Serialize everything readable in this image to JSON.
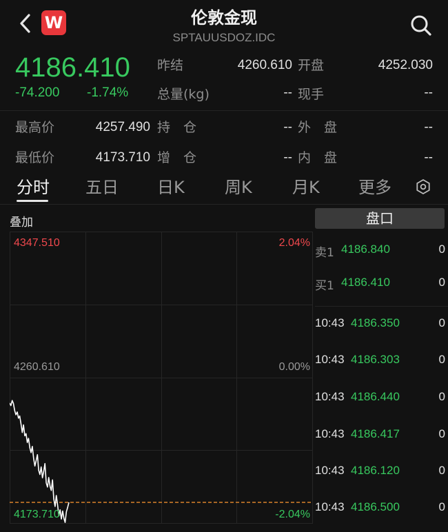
{
  "header": {
    "title": "伦敦金现",
    "code": "SPTAUUSDOZ.IDC",
    "logo_letter": "W",
    "icons": {
      "back": "chevron-left-icon",
      "search": "search-icon",
      "settings": "settings-icon"
    }
  },
  "quote": {
    "last": "4186.410",
    "change": "-74.200",
    "change_pct": "-1.74%",
    "fields": {
      "prev_close_label": "昨结",
      "prev_close": "4260.610",
      "open_label": "开盘",
      "open": "4252.030",
      "volume_label": "总量(kg)",
      "volume": "--",
      "current_hand_label": "现手",
      "current_hand": "--",
      "high_label": "最高价",
      "high": "4257.490",
      "hold_label": "持　仓",
      "hold": "--",
      "outer_label": "外　盘",
      "outer": "--",
      "low_label": "最低价",
      "low": "4173.710",
      "add_label": "增　仓",
      "add": "--",
      "inner_label": "内　盘",
      "inner": "--"
    }
  },
  "tabs": [
    "分时",
    "五日",
    "日K",
    "周K",
    "月K",
    "更多"
  ],
  "active_tab": "分时",
  "chart": {
    "overlay_label": "叠加",
    "top_price": "4347.510",
    "top_pct": "2.04%",
    "mid_price": "4260.610",
    "mid_pct": "0.00%",
    "bottom_price": "4173.710",
    "bottom_pct": "-2.04%"
  },
  "chart_data": {
    "type": "line",
    "title": "",
    "ylim": [
      4173.71,
      4347.51
    ],
    "reference": 4260.61,
    "grid": true,
    "series": [
      {
        "values": [
          4245.5,
          4244.0,
          4247.0,
          4245.2,
          4241.0,
          4238.5,
          4240.2,
          4236.5,
          4237.8,
          4233.0,
          4228.0,
          4232.5,
          4226.0,
          4227.3,
          4222.0,
          4224.5,
          4218.8,
          4216.0,
          4219.7,
          4212.5,
          4208.0,
          4211.2,
          4214.8,
          4205.5,
          4203.0,
          4207.5,
          4201.0,
          4204.8,
          4209.5,
          4198.0,
          4195.5,
          4201.2,
          4196.0,
          4193.5,
          4199.8,
          4188.5,
          4184.0,
          4190.5,
          4185.0,
          4178.5,
          4182.0,
          4176.5,
          4181.3,
          4177.0,
          4174.5,
          4180.8,
          4183.5,
          4186.4
        ]
      }
    ]
  },
  "panel": {
    "pankou_label": "盘口",
    "orderbook": [
      {
        "side": "卖1",
        "price": "4186.840",
        "qty": "0"
      },
      {
        "side": "买1",
        "price": "4186.410",
        "qty": "0"
      }
    ],
    "trades": [
      {
        "time": "10:43",
        "price": "4186.350",
        "qty": "0"
      },
      {
        "time": "10:43",
        "price": "4186.303",
        "qty": "0"
      },
      {
        "time": "10:43",
        "price": "4186.440",
        "qty": "0"
      },
      {
        "time": "10:43",
        "price": "4186.417",
        "qty": "0"
      },
      {
        "time": "10:43",
        "price": "4186.120",
        "qty": "0"
      },
      {
        "time": "10:43",
        "price": "4186.500",
        "qty": "0"
      }
    ]
  },
  "colors": {
    "down": "#38c95f",
    "up": "#f0484d",
    "baseline": "#d9822b",
    "line": "#ffffff",
    "grid": "#262626"
  }
}
